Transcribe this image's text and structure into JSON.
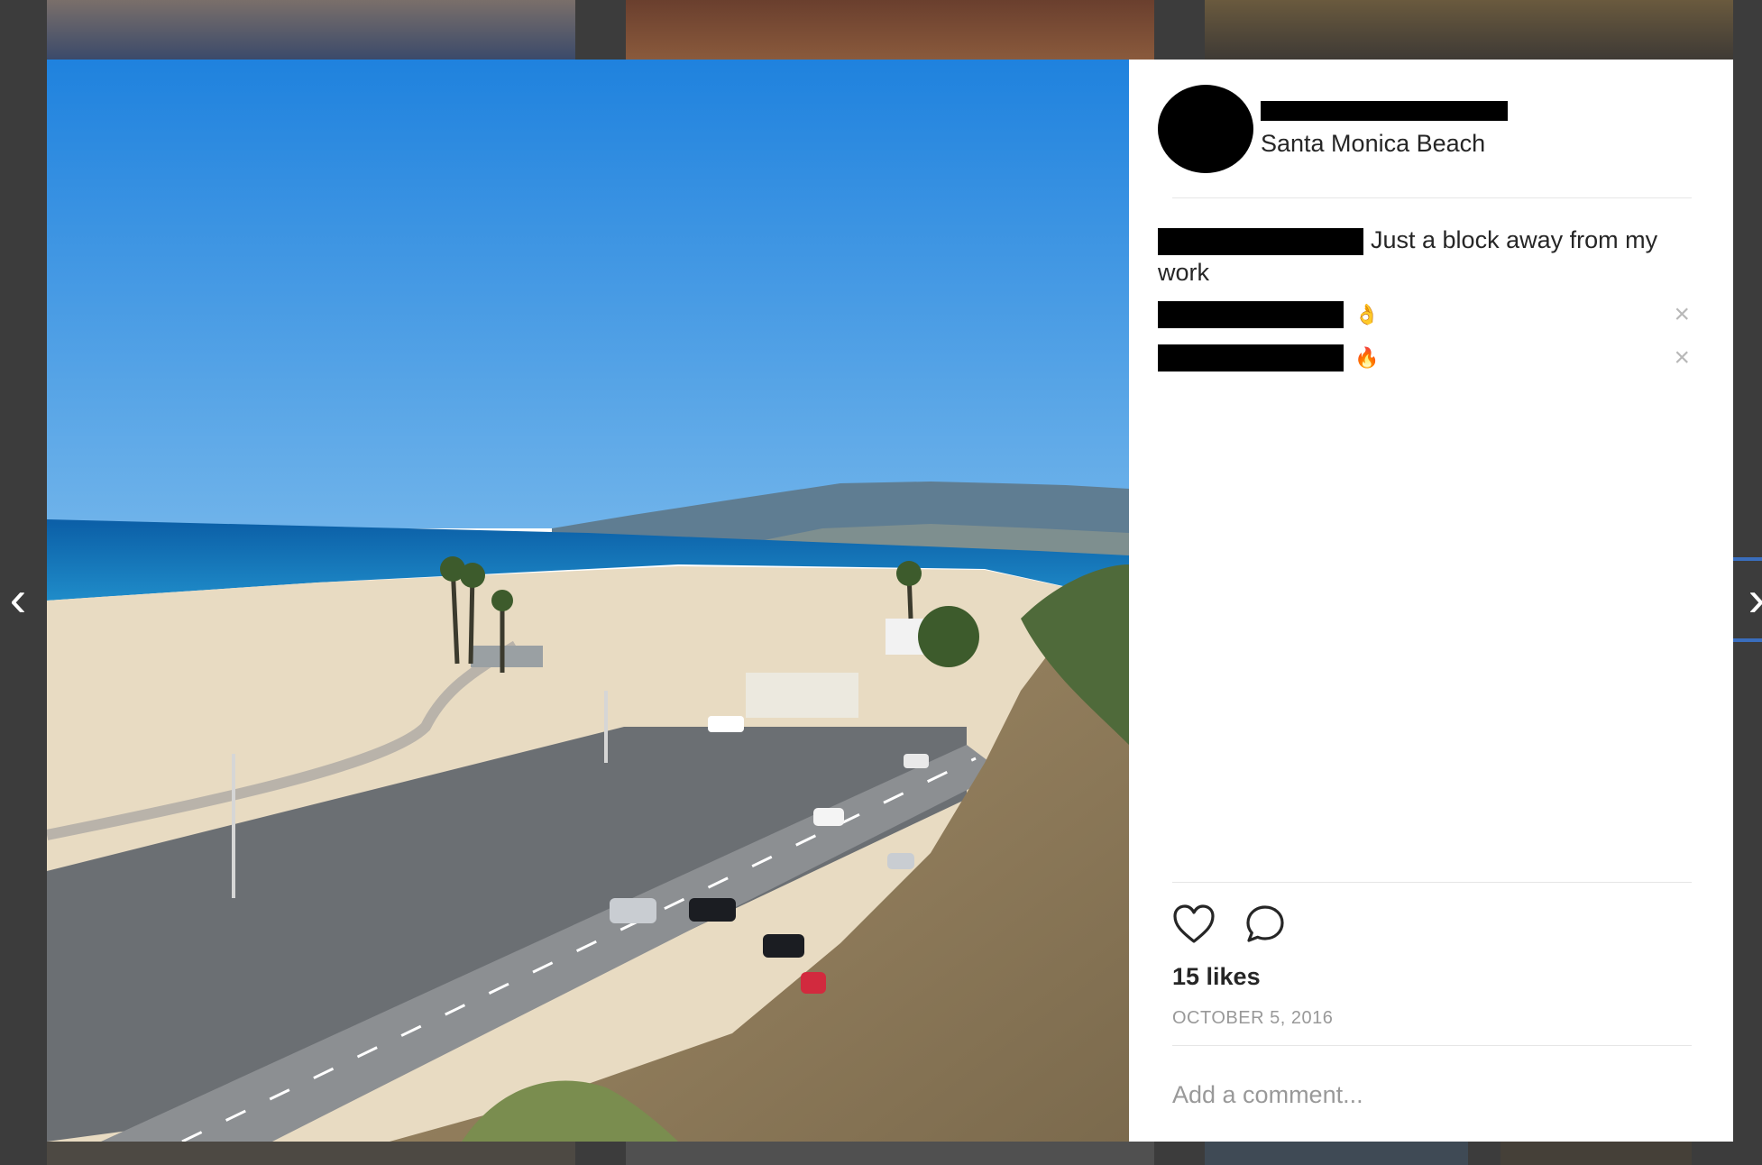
{
  "post": {
    "location": "Santa Monica Beach",
    "caption": "Just a block away from my work",
    "comments": [
      {
        "emoji": "👌",
        "icon": "close-icon"
      },
      {
        "emoji": "🔥",
        "icon": "close-icon"
      }
    ],
    "likes": "15 likes",
    "date": "OCTOBER 5, 2016",
    "comment_placeholder": "Add a comment..."
  },
  "nav": {
    "prev": "‹",
    "next": "›"
  },
  "icons": {
    "like": "heart-icon",
    "comment": "speech-bubble-icon",
    "remove": "×"
  },
  "colors": {
    "text": "#262626",
    "muted": "#999999",
    "divider": "#e6e6e6",
    "sky": "#2e8fe0",
    "sea": "#0e6fb5",
    "sand": "#e9dcc4"
  }
}
